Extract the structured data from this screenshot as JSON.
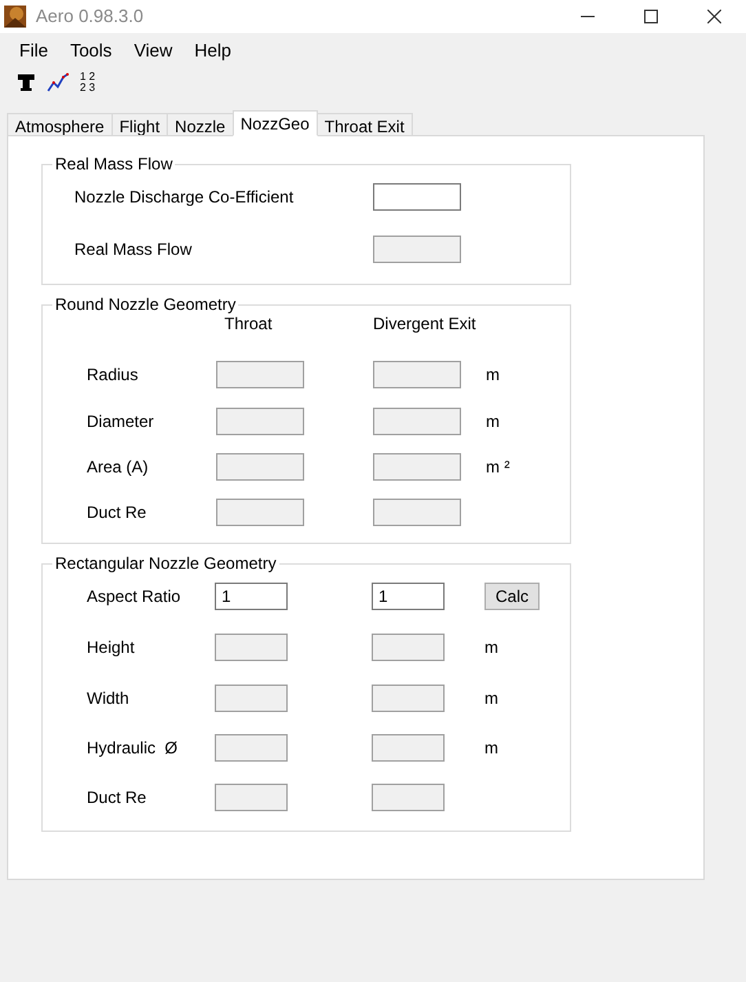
{
  "window": {
    "title": "Aero 0.98.3.0"
  },
  "menu": [
    "File",
    "Tools",
    "View",
    "Help"
  ],
  "toolbar": [
    {
      "kind": "font"
    },
    {
      "kind": "chart"
    },
    {
      "kind": "numbers",
      "lines": [
        "1 2",
        "2 3"
      ]
    }
  ],
  "tabs": [
    {
      "label": "Atmosphere",
      "selected": false
    },
    {
      "label": "Flight",
      "selected": false
    },
    {
      "label": "Nozzle",
      "selected": false
    },
    {
      "label": "NozzGeo",
      "selected": true
    },
    {
      "label": "Throat Exit",
      "selected": false
    }
  ],
  "groups": [
    {
      "title": "Real Mass Flow",
      "kind": "single",
      "rows": [
        {
          "label": "Nozzle Discharge Co-Efficient",
          "fields": [
            {
              "editable": true
            }
          ]
        },
        {
          "label": "Real Mass Flow",
          "fields": [
            {
              "editable": false
            }
          ]
        }
      ]
    },
    {
      "title": "Round Nozzle Geometry",
      "kind": "round",
      "columns": [
        "Throat",
        "Divergent Exit"
      ],
      "rows": [
        {
          "label": "Radius",
          "fields": [
            {
              "editable": false
            },
            {
              "editable": false
            }
          ],
          "unit": "m"
        },
        {
          "label": "Diameter",
          "fields": [
            {
              "editable": false
            },
            {
              "editable": false
            }
          ],
          "unit": "m"
        },
        {
          "label": "Area (A)",
          "fields": [
            {
              "editable": false
            },
            {
              "editable": false
            }
          ],
          "unit": "m ²"
        },
        {
          "label": "Duct Re",
          "fields": [
            {
              "editable": false
            },
            {
              "editable": false
            }
          ]
        }
      ]
    },
    {
      "title": "Rectangular Nozzle Geometry",
      "kind": "rect",
      "rows": [
        {
          "label": "Aspect Ratio",
          "fields": [
            {
              "editable": true,
              "value": "1"
            },
            {
              "editable": true,
              "value": "1"
            }
          ],
          "button": "Calc"
        },
        {
          "label": "Height",
          "fields": [
            {
              "editable": false
            },
            {
              "editable": false
            }
          ],
          "unit": "m"
        },
        {
          "label": "Width",
          "fields": [
            {
              "editable": false
            },
            {
              "editable": false
            }
          ],
          "unit": "m"
        },
        {
          "label": "Hydraulic  Ø",
          "fields": [
            {
              "editable": false
            },
            {
              "editable": false
            }
          ],
          "unit": "m"
        },
        {
          "label": "Duct Re",
          "fields": [
            {
              "editable": false
            },
            {
              "editable": false
            }
          ]
        }
      ]
    }
  ]
}
